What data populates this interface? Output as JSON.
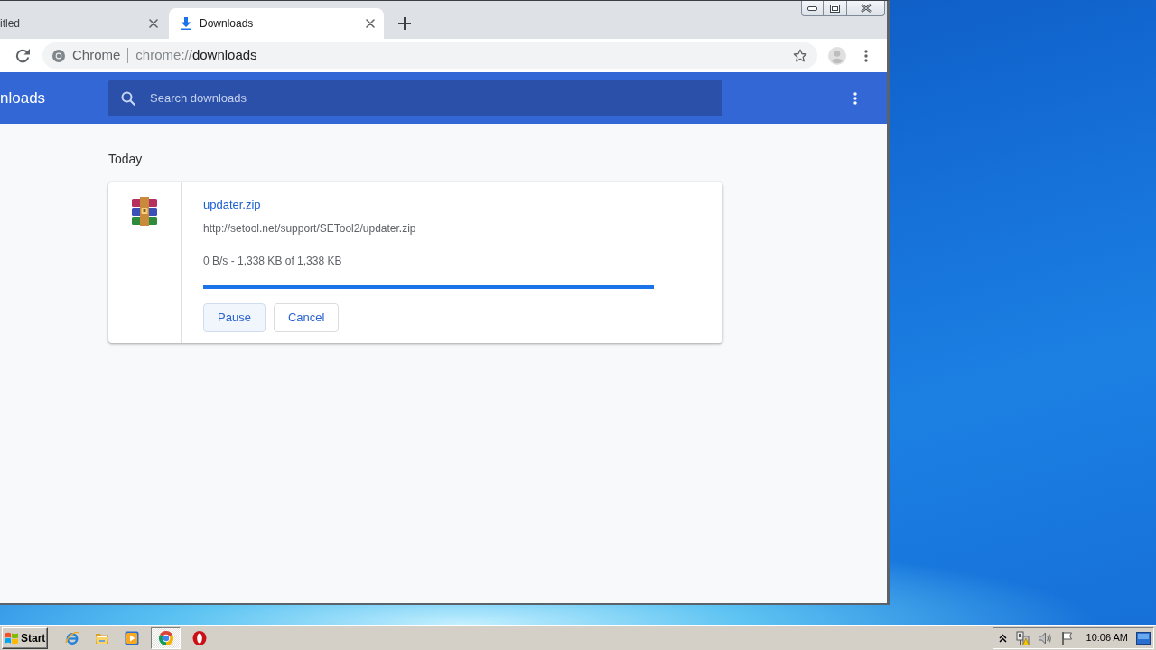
{
  "browser": {
    "tabs": [
      {
        "kind": "page",
        "title": "itled",
        "selected": false
      },
      {
        "kind": "downloads",
        "title": "Downloads",
        "selected": true
      }
    ],
    "omnibox": {
      "chip": "Chrome",
      "scheme": "chrome://",
      "path": "downloads"
    }
  },
  "page": {
    "title": "nloads",
    "search": {
      "placeholder": "Search downloads"
    },
    "sections": [
      {
        "heading": "Today",
        "downloads": [
          {
            "file_name": "updater.zip",
            "url": "http://setool.net/support/SETool2/updater.zip",
            "status": "0 B/s - 1,338 KB of 1,338 KB",
            "level": 1,
            "buttons": [
              {
                "label": "Pause",
                "highlighted": true
              },
              {
                "label": "Cancel",
                "highlighted": false
              }
            ]
          }
        ]
      }
    ]
  },
  "taskbar": {
    "start": "Start",
    "apps": [
      {
        "kind": "ie",
        "active": false
      },
      {
        "kind": "explorer",
        "active": false
      },
      {
        "kind": "media",
        "active": false
      },
      {
        "kind": "chrome",
        "active": true
      },
      {
        "kind": "opera",
        "active": false
      }
    ],
    "clock": "10:06 AM"
  }
}
